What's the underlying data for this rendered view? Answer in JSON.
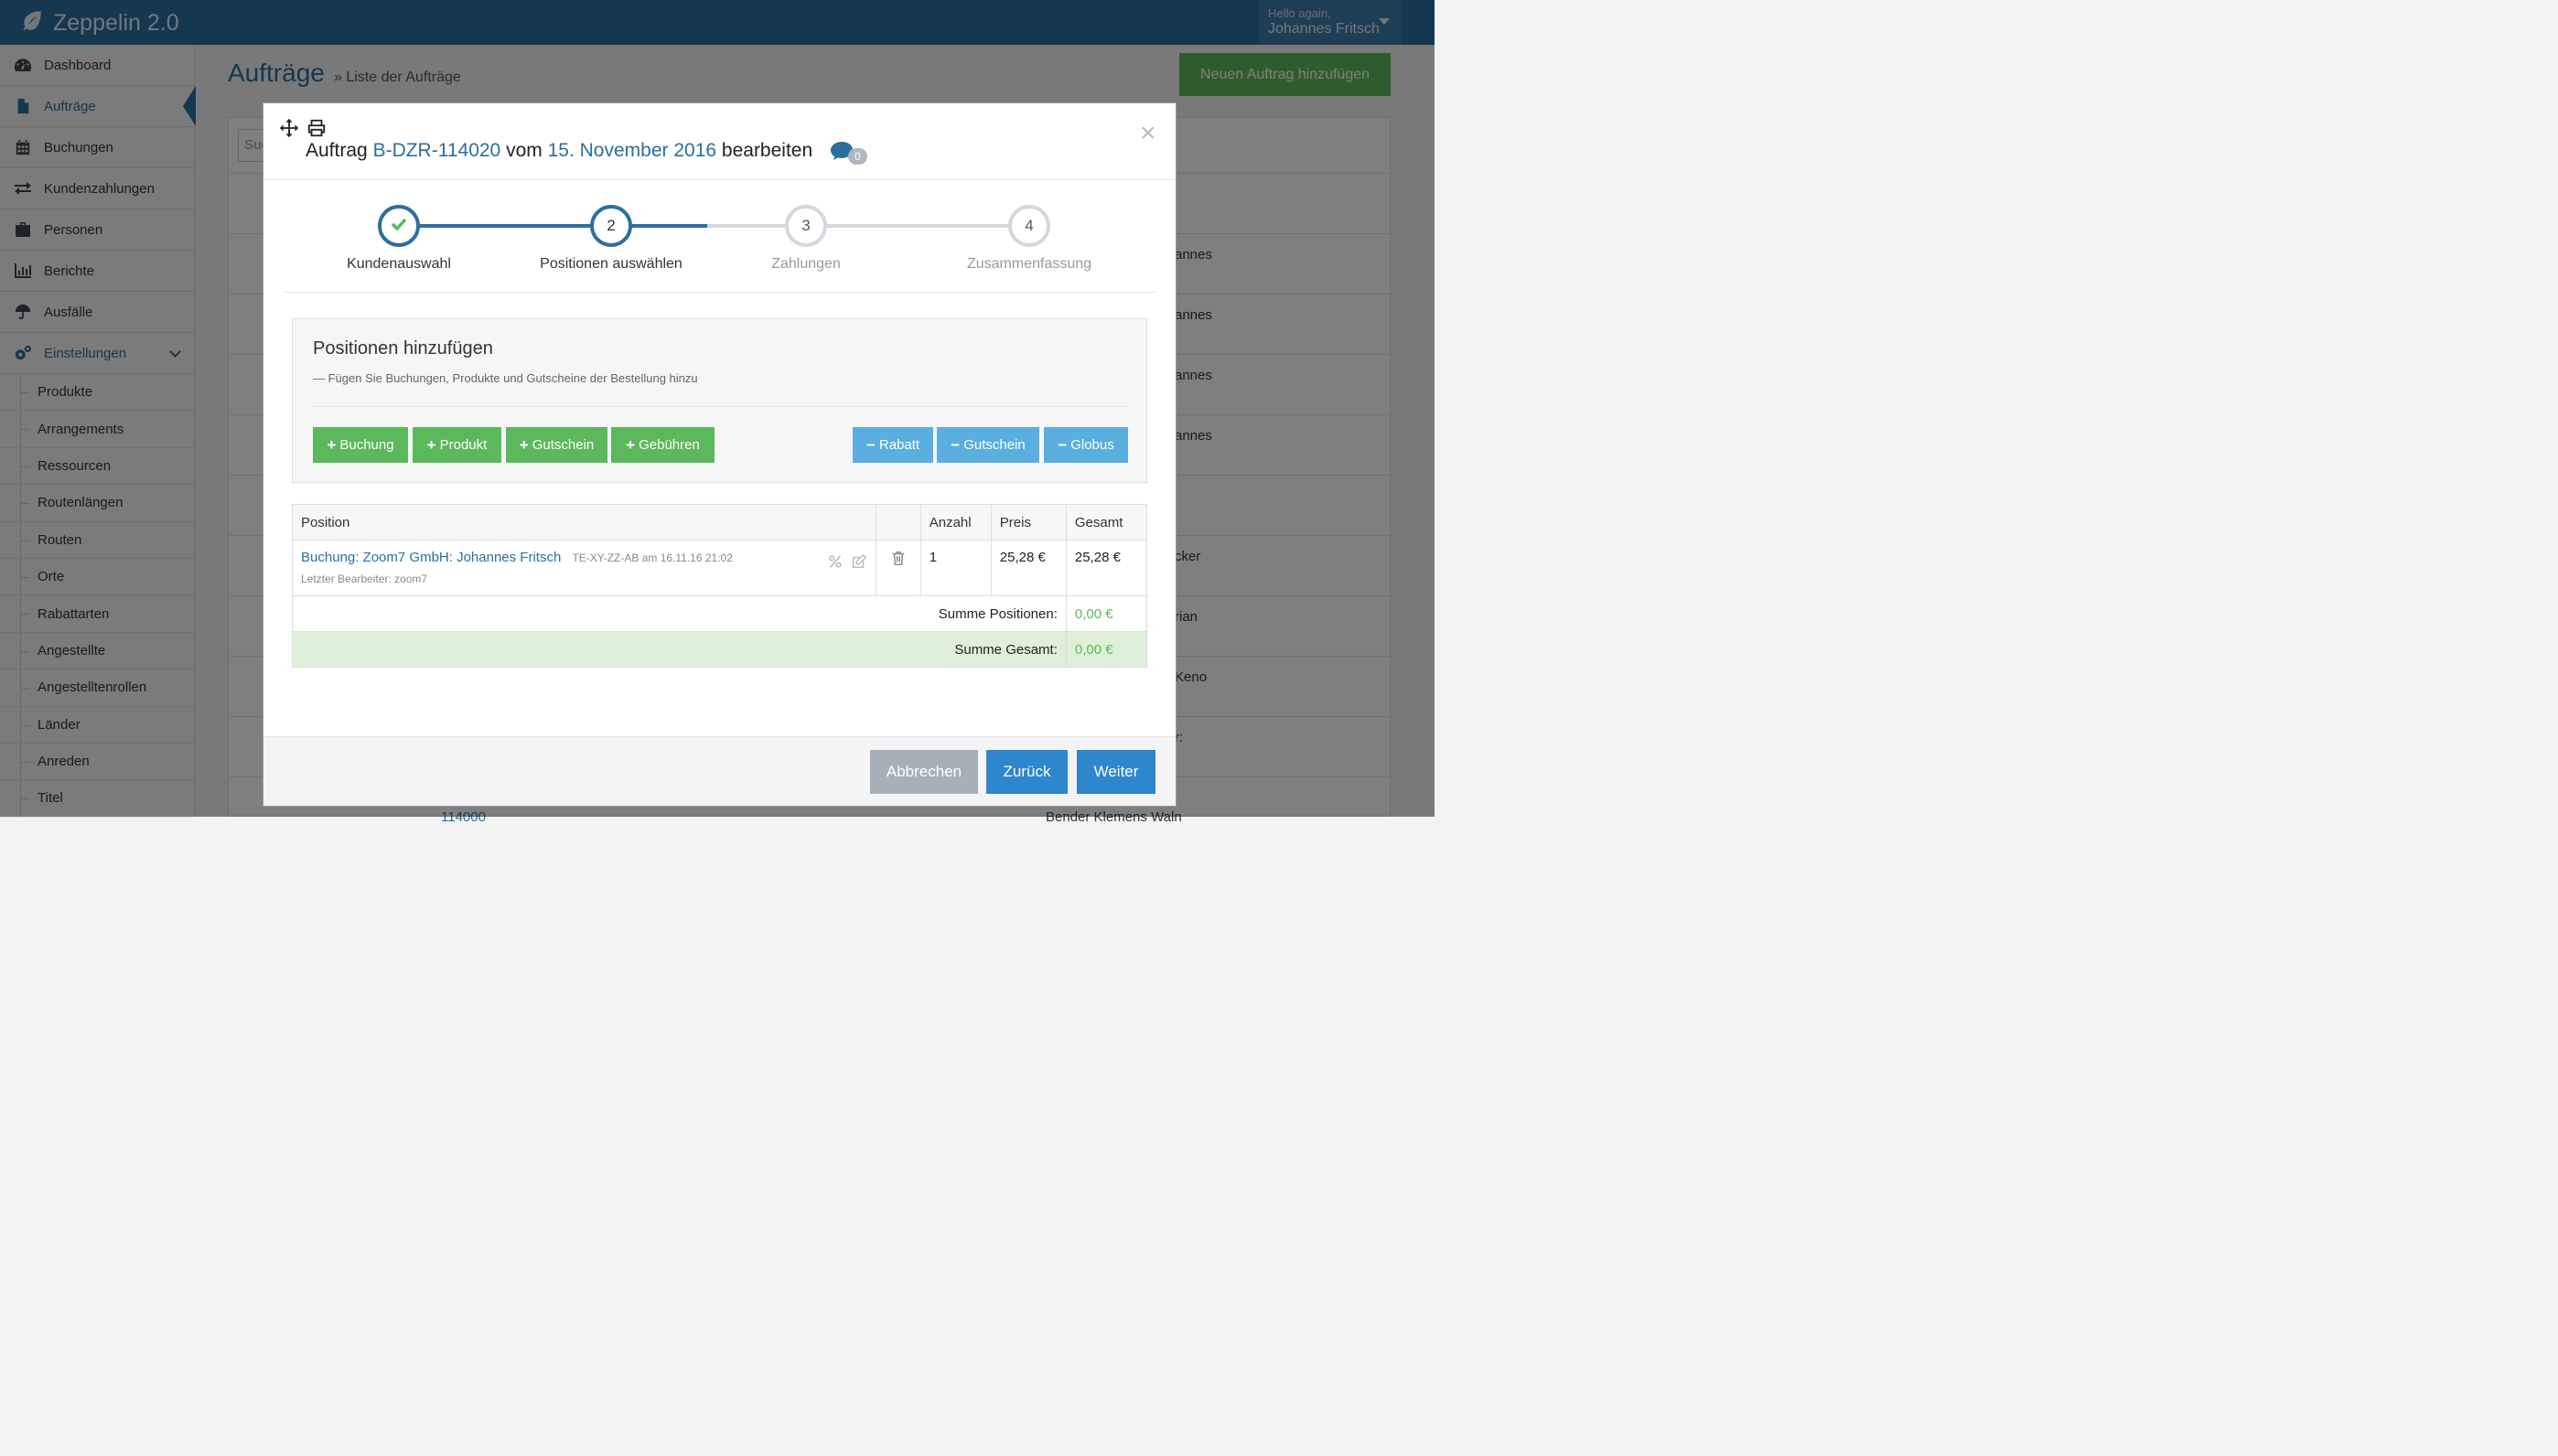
{
  "app": {
    "title": "Zeppelin 2.0"
  },
  "user": {
    "greeting": "Hello again,",
    "name": "Johannes Fritsch"
  },
  "sidebar": {
    "items": [
      {
        "label": "Dashboard",
        "icon": "dashboard-icon"
      },
      {
        "label": "Aufträge",
        "icon": "document-icon",
        "active": true
      },
      {
        "label": "Buchungen",
        "icon": "calendar-icon"
      },
      {
        "label": "Kundenzahlungen",
        "icon": "exchange-icon"
      },
      {
        "label": "Personen",
        "icon": "briefcase-icon"
      },
      {
        "label": "Berichte",
        "icon": "bar-chart-icon"
      },
      {
        "label": "Ausfälle",
        "icon": "umbrella-icon"
      },
      {
        "label": "Einstellungen",
        "icon": "gears-icon",
        "expanded": true
      }
    ],
    "settings_sub": [
      "Produkte",
      "Arrangements",
      "Ressourcen",
      "Routenlängen",
      "Routen",
      "Orte",
      "Rabattarten",
      "Angestellte",
      "Angestelltenrollen",
      "Länder",
      "Anreden",
      "Titel"
    ]
  },
  "main": {
    "title": "Aufträge",
    "breadcrumb": "» Liste der Aufträge",
    "add_button": "Neuen Auftrag hinzufügen",
    "search_placeholder": "Suc",
    "bg_cells": [
      "annes",
      "annes",
      "annes",
      "annes",
      "cker",
      "rian",
      "Keno",
      "r:"
    ],
    "bg_bottom_left": "114000",
    "bg_bottom_right": "Bender Klemens Waln"
  },
  "modal": {
    "title_prefix": "Auftrag",
    "order_id": "B-DZR-114020",
    "title_mid": "vom",
    "order_date": "15. November 2016",
    "title_suffix": "bearbeiten",
    "comment_count": "0",
    "close": "×",
    "steps": [
      {
        "num": "✓",
        "label": "Kundenauswahl",
        "state": "done"
      },
      {
        "num": "2",
        "label": "Positionen auswählen",
        "state": "current"
      },
      {
        "num": "3",
        "label": "Zahlungen",
        "state": "todo"
      },
      {
        "num": "4",
        "label": "Zusammenfassung",
        "state": "todo"
      }
    ],
    "add_panel": {
      "title": "Positionen hinzufügen",
      "subtitle": "— Fügen Sie Buchungen, Produkte und Gutscheine der Bestellung hinzu",
      "add_buttons": [
        "Buchung",
        "Produkt",
        "Gutschein",
        "Gebühren"
      ],
      "sub_buttons": [
        "Rabatt",
        "Gutschein",
        "Globus"
      ]
    },
    "table": {
      "headers": [
        "Position",
        "",
        "Anzahl",
        "Preis",
        "Gesamt"
      ],
      "rows": [
        {
          "position": "Buchung: Zoom7 GmbH: Johannes Fritsch",
          "meta": "TE-XY-ZZ-AB am 16.11.16 21:02",
          "editor": "Letzter Bearbeiter: zoom7",
          "quantity": "1",
          "price": "25,28 €",
          "total": "25,28 €"
        }
      ],
      "sum_positions_label": "Summe Positionen:",
      "sum_positions_value": "0,00 €",
      "sum_total_label": "Summe Gesamt:",
      "sum_total_value": "0,00 €"
    },
    "footer": {
      "cancel": "Abbrechen",
      "back": "Zurück",
      "next": "Weiter"
    }
  },
  "colors": {
    "brand": "#2b6f9e",
    "success": "#5cb85c",
    "info": "#5aaee0",
    "primary": "#2e86cc"
  }
}
